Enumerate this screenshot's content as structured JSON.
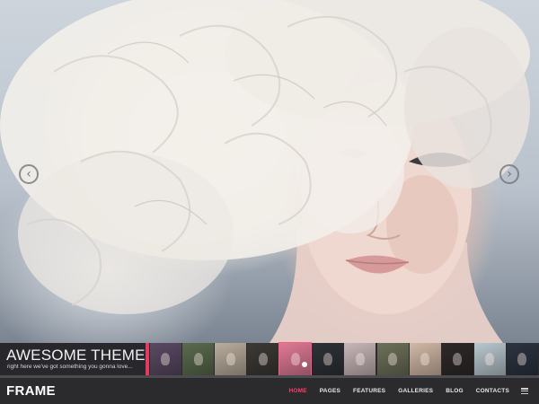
{
  "hero": {
    "image": "woman-with-curly-blonde-hair",
    "prev_icon": "chevron-left-icon",
    "next_icon": "chevron-right-icon"
  },
  "caption": {
    "title": "AWESOME THEME",
    "subtitle": "right here we've got something you gonna love..."
  },
  "thumbnails": [
    {
      "name": "thumb-1",
      "color": "#5a4a63"
    },
    {
      "name": "thumb-2",
      "color": "#5b6b4e"
    },
    {
      "name": "thumb-3",
      "color": "#b9ad9d"
    },
    {
      "name": "thumb-4",
      "color": "#3d3a35"
    },
    {
      "name": "thumb-5",
      "color": "#e07a95"
    },
    {
      "name": "thumb-6",
      "color": "#2e3338"
    },
    {
      "name": "thumb-7",
      "color": "#c8b7b9"
    },
    {
      "name": "thumb-8",
      "color": "#6d7159"
    },
    {
      "name": "thumb-9",
      "color": "#d2b9a6"
    },
    {
      "name": "thumb-10",
      "color": "#2f2a2a"
    },
    {
      "name": "thumb-11",
      "color": "#b9c8cf"
    },
    {
      "name": "thumb-12",
      "color": "#2c3440"
    }
  ],
  "navbar": {
    "logo": "FRAME",
    "items": [
      "HOME",
      "PAGES",
      "FEATURES",
      "GALLERIES",
      "BLOG",
      "CONTACTS"
    ],
    "active": "HOME",
    "menu_icon": "hamburger-icon"
  },
  "colors": {
    "accent": "#e63a63",
    "active_nav": "#ff3d6b",
    "bar_bg": "#2b2b2e"
  }
}
